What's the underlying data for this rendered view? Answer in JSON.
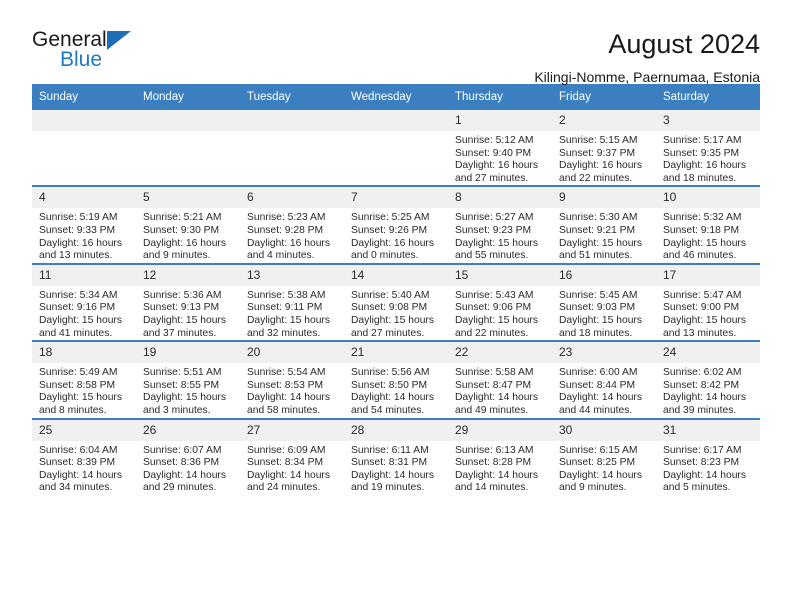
{
  "brand": {
    "name_part1": "General",
    "name_part2": "Blue",
    "accent_color": "#1f7ac4",
    "header_color": "#3c7fc1"
  },
  "header": {
    "title": "August 2024",
    "subtitle": "Kilingi-Nomme, Paernumaa, Estonia"
  },
  "weekdays": [
    "Sunday",
    "Monday",
    "Tuesday",
    "Wednesday",
    "Thursday",
    "Friday",
    "Saturday"
  ],
  "weeks": [
    [
      {
        "day": "",
        "blank": true
      },
      {
        "day": "",
        "blank": true
      },
      {
        "day": "",
        "blank": true
      },
      {
        "day": "",
        "blank": true
      },
      {
        "day": "1",
        "sunrise": "Sunrise: 5:12 AM",
        "sunset": "Sunset: 9:40 PM",
        "daylight1": "Daylight: 16 hours",
        "daylight2": "and 27 minutes."
      },
      {
        "day": "2",
        "sunrise": "Sunrise: 5:15 AM",
        "sunset": "Sunset: 9:37 PM",
        "daylight1": "Daylight: 16 hours",
        "daylight2": "and 22 minutes."
      },
      {
        "day": "3",
        "sunrise": "Sunrise: 5:17 AM",
        "sunset": "Sunset: 9:35 PM",
        "daylight1": "Daylight: 16 hours",
        "daylight2": "and 18 minutes."
      }
    ],
    [
      {
        "day": "4",
        "sunrise": "Sunrise: 5:19 AM",
        "sunset": "Sunset: 9:33 PM",
        "daylight1": "Daylight: 16 hours",
        "daylight2": "and 13 minutes."
      },
      {
        "day": "5",
        "sunrise": "Sunrise: 5:21 AM",
        "sunset": "Sunset: 9:30 PM",
        "daylight1": "Daylight: 16 hours",
        "daylight2": "and 9 minutes."
      },
      {
        "day": "6",
        "sunrise": "Sunrise: 5:23 AM",
        "sunset": "Sunset: 9:28 PM",
        "daylight1": "Daylight: 16 hours",
        "daylight2": "and 4 minutes."
      },
      {
        "day": "7",
        "sunrise": "Sunrise: 5:25 AM",
        "sunset": "Sunset: 9:26 PM",
        "daylight1": "Daylight: 16 hours",
        "daylight2": "and 0 minutes."
      },
      {
        "day": "8",
        "sunrise": "Sunrise: 5:27 AM",
        "sunset": "Sunset: 9:23 PM",
        "daylight1": "Daylight: 15 hours",
        "daylight2": "and 55 minutes."
      },
      {
        "day": "9",
        "sunrise": "Sunrise: 5:30 AM",
        "sunset": "Sunset: 9:21 PM",
        "daylight1": "Daylight: 15 hours",
        "daylight2": "and 51 minutes."
      },
      {
        "day": "10",
        "sunrise": "Sunrise: 5:32 AM",
        "sunset": "Sunset: 9:18 PM",
        "daylight1": "Daylight: 15 hours",
        "daylight2": "and 46 minutes."
      }
    ],
    [
      {
        "day": "11",
        "sunrise": "Sunrise: 5:34 AM",
        "sunset": "Sunset: 9:16 PM",
        "daylight1": "Daylight: 15 hours",
        "daylight2": "and 41 minutes."
      },
      {
        "day": "12",
        "sunrise": "Sunrise: 5:36 AM",
        "sunset": "Sunset: 9:13 PM",
        "daylight1": "Daylight: 15 hours",
        "daylight2": "and 37 minutes."
      },
      {
        "day": "13",
        "sunrise": "Sunrise: 5:38 AM",
        "sunset": "Sunset: 9:11 PM",
        "daylight1": "Daylight: 15 hours",
        "daylight2": "and 32 minutes."
      },
      {
        "day": "14",
        "sunrise": "Sunrise: 5:40 AM",
        "sunset": "Sunset: 9:08 PM",
        "daylight1": "Daylight: 15 hours",
        "daylight2": "and 27 minutes."
      },
      {
        "day": "15",
        "sunrise": "Sunrise: 5:43 AM",
        "sunset": "Sunset: 9:06 PM",
        "daylight1": "Daylight: 15 hours",
        "daylight2": "and 22 minutes."
      },
      {
        "day": "16",
        "sunrise": "Sunrise: 5:45 AM",
        "sunset": "Sunset: 9:03 PM",
        "daylight1": "Daylight: 15 hours",
        "daylight2": "and 18 minutes."
      },
      {
        "day": "17",
        "sunrise": "Sunrise: 5:47 AM",
        "sunset": "Sunset: 9:00 PM",
        "daylight1": "Daylight: 15 hours",
        "daylight2": "and 13 minutes."
      }
    ],
    [
      {
        "day": "18",
        "sunrise": "Sunrise: 5:49 AM",
        "sunset": "Sunset: 8:58 PM",
        "daylight1": "Daylight: 15 hours",
        "daylight2": "and 8 minutes."
      },
      {
        "day": "19",
        "sunrise": "Sunrise: 5:51 AM",
        "sunset": "Sunset: 8:55 PM",
        "daylight1": "Daylight: 15 hours",
        "daylight2": "and 3 minutes."
      },
      {
        "day": "20",
        "sunrise": "Sunrise: 5:54 AM",
        "sunset": "Sunset: 8:53 PM",
        "daylight1": "Daylight: 14 hours",
        "daylight2": "and 58 minutes."
      },
      {
        "day": "21",
        "sunrise": "Sunrise: 5:56 AM",
        "sunset": "Sunset: 8:50 PM",
        "daylight1": "Daylight: 14 hours",
        "daylight2": "and 54 minutes."
      },
      {
        "day": "22",
        "sunrise": "Sunrise: 5:58 AM",
        "sunset": "Sunset: 8:47 PM",
        "daylight1": "Daylight: 14 hours",
        "daylight2": "and 49 minutes."
      },
      {
        "day": "23",
        "sunrise": "Sunrise: 6:00 AM",
        "sunset": "Sunset: 8:44 PM",
        "daylight1": "Daylight: 14 hours",
        "daylight2": "and 44 minutes."
      },
      {
        "day": "24",
        "sunrise": "Sunrise: 6:02 AM",
        "sunset": "Sunset: 8:42 PM",
        "daylight1": "Daylight: 14 hours",
        "daylight2": "and 39 minutes."
      }
    ],
    [
      {
        "day": "25",
        "sunrise": "Sunrise: 6:04 AM",
        "sunset": "Sunset: 8:39 PM",
        "daylight1": "Daylight: 14 hours",
        "daylight2": "and 34 minutes."
      },
      {
        "day": "26",
        "sunrise": "Sunrise: 6:07 AM",
        "sunset": "Sunset: 8:36 PM",
        "daylight1": "Daylight: 14 hours",
        "daylight2": "and 29 minutes."
      },
      {
        "day": "27",
        "sunrise": "Sunrise: 6:09 AM",
        "sunset": "Sunset: 8:34 PM",
        "daylight1": "Daylight: 14 hours",
        "daylight2": "and 24 minutes."
      },
      {
        "day": "28",
        "sunrise": "Sunrise: 6:11 AM",
        "sunset": "Sunset: 8:31 PM",
        "daylight1": "Daylight: 14 hours",
        "daylight2": "and 19 minutes."
      },
      {
        "day": "29",
        "sunrise": "Sunrise: 6:13 AM",
        "sunset": "Sunset: 8:28 PM",
        "daylight1": "Daylight: 14 hours",
        "daylight2": "and 14 minutes."
      },
      {
        "day": "30",
        "sunrise": "Sunrise: 6:15 AM",
        "sunset": "Sunset: 8:25 PM",
        "daylight1": "Daylight: 14 hours",
        "daylight2": "and 9 minutes."
      },
      {
        "day": "31",
        "sunrise": "Sunrise: 6:17 AM",
        "sunset": "Sunset: 8:23 PM",
        "daylight1": "Daylight: 14 hours",
        "daylight2": "and 5 minutes."
      }
    ]
  ]
}
